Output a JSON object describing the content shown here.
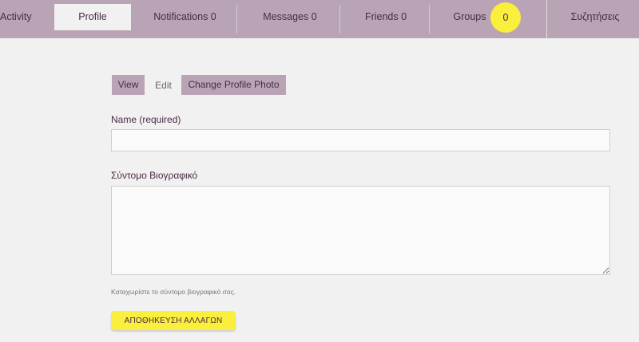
{
  "nav": {
    "activity": "Activity",
    "profile": "Profile",
    "notifications": "Notifications 0",
    "messages": "Messages 0",
    "friends": "Friends 0",
    "groups": "Groups",
    "groups_badge": "0",
    "discussions": "Συζητήσεις"
  },
  "subnav": {
    "view": "View",
    "edit": "Edit",
    "change_photo": "Change Profile Photo"
  },
  "form": {
    "name_label": "Name (required)",
    "name_value": "",
    "bio_label": "Σύντομο Βιογραφικό",
    "bio_value": "",
    "bio_help": "Καταχωρίστε το σύντομο βιογραφικό σας.",
    "save_label": "ΑΠΟΘΗΚΕΥΣΗ ΑΛΛΑΓΩΝ"
  },
  "colors": {
    "nav_bg": "#b9a4b5",
    "accent_yellow": "#f9ef3c",
    "text": "#4a2a44",
    "page_bg": "#f1f1f1"
  }
}
